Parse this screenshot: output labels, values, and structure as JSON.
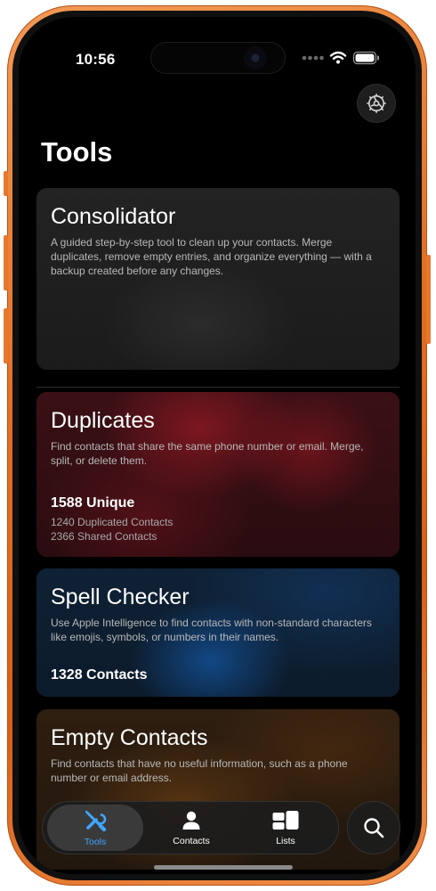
{
  "status_bar": {
    "time": "10:56"
  },
  "header": {
    "title": "Tools",
    "settings_icon": "gear-icon"
  },
  "cards": {
    "consolidator": {
      "title": "Consolidator",
      "description": "A guided step-by-step tool to clean up your contacts. Merge duplicates, remove empty entries, and organize everything — with a backup created before any changes."
    },
    "duplicates": {
      "title": "Duplicates",
      "description": "Find contacts that share the same phone number or email. Merge, split, or delete them.",
      "stat_main": "1588 Unique",
      "stat_sub_1": "1240 Duplicated Contacts",
      "stat_sub_2": "2366 Shared Contacts",
      "accent": "#8b1a22"
    },
    "spell_checker": {
      "title": "Spell Checker",
      "description": "Use Apple Intelligence to find contacts with non-standard characters like emojis, symbols, or numbers in their names.",
      "stat_main": "1328 Contacts",
      "accent": "#0f3f73"
    },
    "empty_contacts": {
      "title": "Empty Contacts",
      "description": "Find contacts that have no useful information, such as a phone number or email address.",
      "accent": "#6b3d12"
    }
  },
  "tabbar": {
    "tabs": [
      {
        "label": "Tools",
        "icon": "wrench-screwdriver-icon",
        "active": true
      },
      {
        "label": "Contacts",
        "icon": "person-icon",
        "active": false
      },
      {
        "label": "Lists",
        "icon": "lists-icon",
        "active": false
      }
    ],
    "search_icon": "search-icon",
    "active_color": "#3ea7ff"
  },
  "frame": {
    "color": "#e36f22"
  }
}
